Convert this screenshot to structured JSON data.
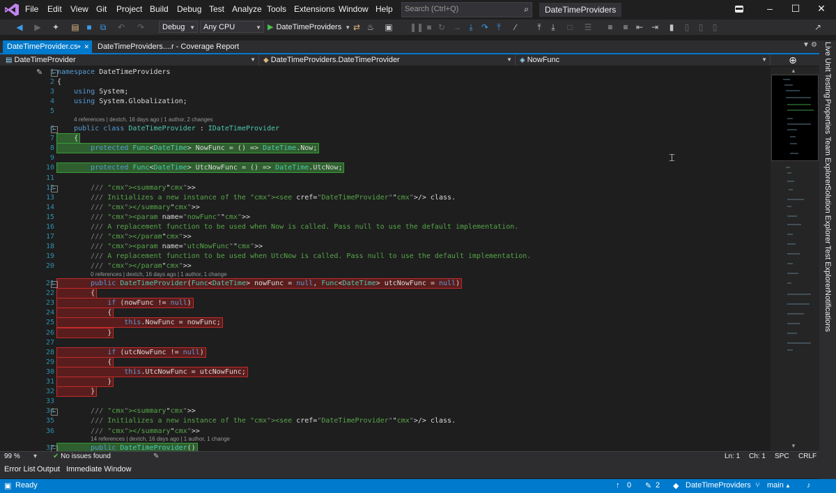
{
  "menu": [
    "File",
    "Edit",
    "View",
    "Git",
    "Project",
    "Build",
    "Debug",
    "Test",
    "Analyze",
    "Tools",
    "Extensions",
    "Window",
    "Help"
  ],
  "search": {
    "placeholder": "Search (Ctrl+Q)"
  },
  "solution_title": "DateTimeProviders",
  "toolbar": {
    "configuration": "Debug",
    "platform": "Any CPU",
    "run_target": "DateTimeProviders"
  },
  "tabs": [
    {
      "label": "DateTimeProvider.cs",
      "active": true
    },
    {
      "label": "DateTimeProviders....r - Coverage Report",
      "active": false
    }
  ],
  "navbar": {
    "project": "DateTimeProvider",
    "type": "DateTimeProviders.DateTimeProvider",
    "member": "NowFunc"
  },
  "code_lens": [
    "4 references | dextch, 16 days ago | 1 author, 2 changes",
    "0 references | dextch, 16 days ago | 1 author, 1 change",
    "14 references | dextch, 16 days ago | 1 author, 1 change"
  ],
  "code_lines": [
    {
      "n": "1",
      "text": "namespace DateTimeProviders"
    },
    {
      "n": "2",
      "text": "{"
    },
    {
      "n": "3",
      "text": "    using System;"
    },
    {
      "n": "4",
      "text": "    using System.Globalization;"
    },
    {
      "n": "5",
      "text": ""
    },
    {
      "n": "6",
      "text": "    public class DateTimeProvider : IDateTimeProvider"
    },
    {
      "n": "7",
      "text": "    {"
    },
    {
      "n": "8",
      "text": "        protected Func<DateTime> NowFunc = () => DateTime.Now;"
    },
    {
      "n": "9",
      "text": ""
    },
    {
      "n": "10",
      "text": "        protected Func<DateTime> UtcNowFunc = () => DateTime.UtcNow;"
    },
    {
      "n": "11",
      "text": ""
    },
    {
      "n": "12",
      "text": "        /// <summary>"
    },
    {
      "n": "13",
      "text": "        /// Initializes a new instance of the <see cref=\"DateTimeProvider\"/> class."
    },
    {
      "n": "14",
      "text": "        /// </summary>"
    },
    {
      "n": "15",
      "text": "        /// <param name=\"nowFunc\">"
    },
    {
      "n": "16",
      "text": "        /// A replacement function to be used when Now is called. Pass null to use the default implementation."
    },
    {
      "n": "17",
      "text": "        /// </param>"
    },
    {
      "n": "18",
      "text": "        /// <param name=\"utcNowFunc\">"
    },
    {
      "n": "19",
      "text": "        /// A replacement function to be used when UtcNow is called. Pass null to use the default implementation."
    },
    {
      "n": "20",
      "text": "        /// </param>"
    },
    {
      "n": "21",
      "text": "        public DateTimeProvider(Func<DateTime> nowFunc = null, Func<DateTime> utcNowFunc = null)"
    },
    {
      "n": "22",
      "text": "        {"
    },
    {
      "n": "23",
      "text": "            if (nowFunc != null)"
    },
    {
      "n": "24",
      "text": "            {"
    },
    {
      "n": "25",
      "text": "                this.NowFunc = nowFunc;"
    },
    {
      "n": "26",
      "text": "            }"
    },
    {
      "n": "27",
      "text": ""
    },
    {
      "n": "28",
      "text": "            if (utcNowFunc != null)"
    },
    {
      "n": "29",
      "text": "            {"
    },
    {
      "n": "30",
      "text": "                this.UtcNowFunc = utcNowFunc;"
    },
    {
      "n": "31",
      "text": "            }"
    },
    {
      "n": "32",
      "text": "        }"
    },
    {
      "n": "33",
      "text": ""
    },
    {
      "n": "34",
      "text": "        /// <summary>"
    },
    {
      "n": "35",
      "text": "        /// Initializes a new instance of the <see cref=\"DateTimeProvider\"/> class."
    },
    {
      "n": "36",
      "text": "        /// </summary>"
    },
    {
      "n": "37",
      "text": "        public DateTimeProvider()"
    }
  ],
  "coverage": {
    "covered_lines": [
      "7",
      "8",
      "10",
      "37"
    ],
    "uncovered_lines": [
      "21",
      "22",
      "23",
      "24",
      "25",
      "26",
      "28",
      "29",
      "30",
      "31",
      "32"
    ]
  },
  "right_sidebar": [
    "Live Unit Testing",
    "Properties",
    "Team Explorer",
    "Solution Explorer",
    "Test Explorer",
    "Notifications"
  ],
  "editor_status": {
    "zoom": "99 %",
    "issues": "No issues found",
    "line": "Ln: 1",
    "column": "Ch: 1",
    "whitespace": "SPC",
    "line_endings": "CRLF"
  },
  "bottom_tabs": [
    "Error List",
    "Output",
    "Immediate Window"
  ],
  "statusbar": {
    "state": "Ready",
    "up_count": "0",
    "pending_changes": "2",
    "repo": "DateTimeProviders",
    "branch": "main"
  },
  "colors": {
    "accent": "#007acc",
    "covered": "#3c9a3c",
    "uncovered": "#c42b2b"
  }
}
